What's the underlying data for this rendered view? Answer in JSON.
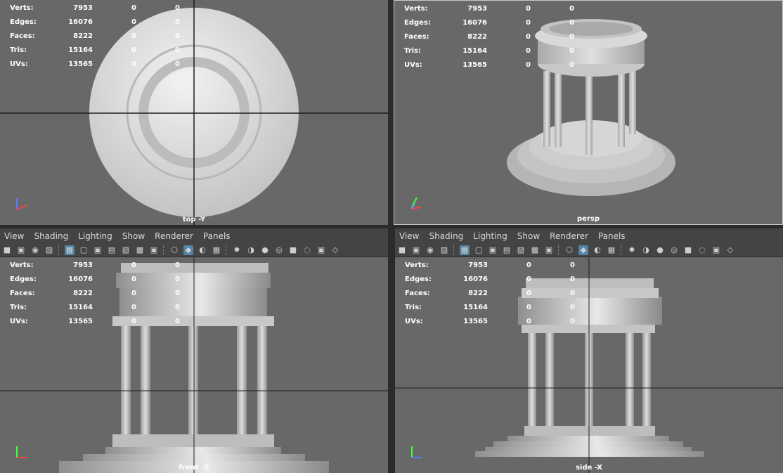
{
  "hud": {
    "labels": [
      "Verts:",
      "Edges:",
      "Faces:",
      "Tris:",
      "UVs:"
    ],
    "values": [
      "7953",
      "16076",
      "8222",
      "15164",
      "13565"
    ],
    "col2": "0",
    "col3": "0"
  },
  "viewports": {
    "top": {
      "label": "top -Y"
    },
    "persp": {
      "label": "persp"
    },
    "front": {
      "label": "front -Z"
    },
    "side": {
      "label": "side -X"
    }
  },
  "menu": {
    "items": [
      "View",
      "Shading",
      "Lighting",
      "Show",
      "Renderer",
      "Panels"
    ]
  },
  "toolbar": {
    "icons": [
      "camera-icon",
      "camera-attr-icon",
      "bookmark-icon",
      "image-plane-icon",
      "grid-icon",
      "film-gate-icon",
      "resolution-gate-icon",
      "gate-mask-icon",
      "field-chart-icon",
      "safe-action-icon",
      "safe-title-icon",
      "wireframe-icon",
      "smooth-shade-icon",
      "default-material-icon",
      "textured-icon",
      "lights-icon",
      "shadows-icon",
      "ambient-occlusion-icon",
      "motion-blur-icon",
      "anti-alias-icon",
      "depth-of-field-icon",
      "isolate-icon",
      "xray-icon"
    ]
  },
  "colors": {
    "viewport_bg": "#686868",
    "panel_bg": "#444444",
    "highlight": "#5285a6",
    "model": "#c9c9c9"
  }
}
